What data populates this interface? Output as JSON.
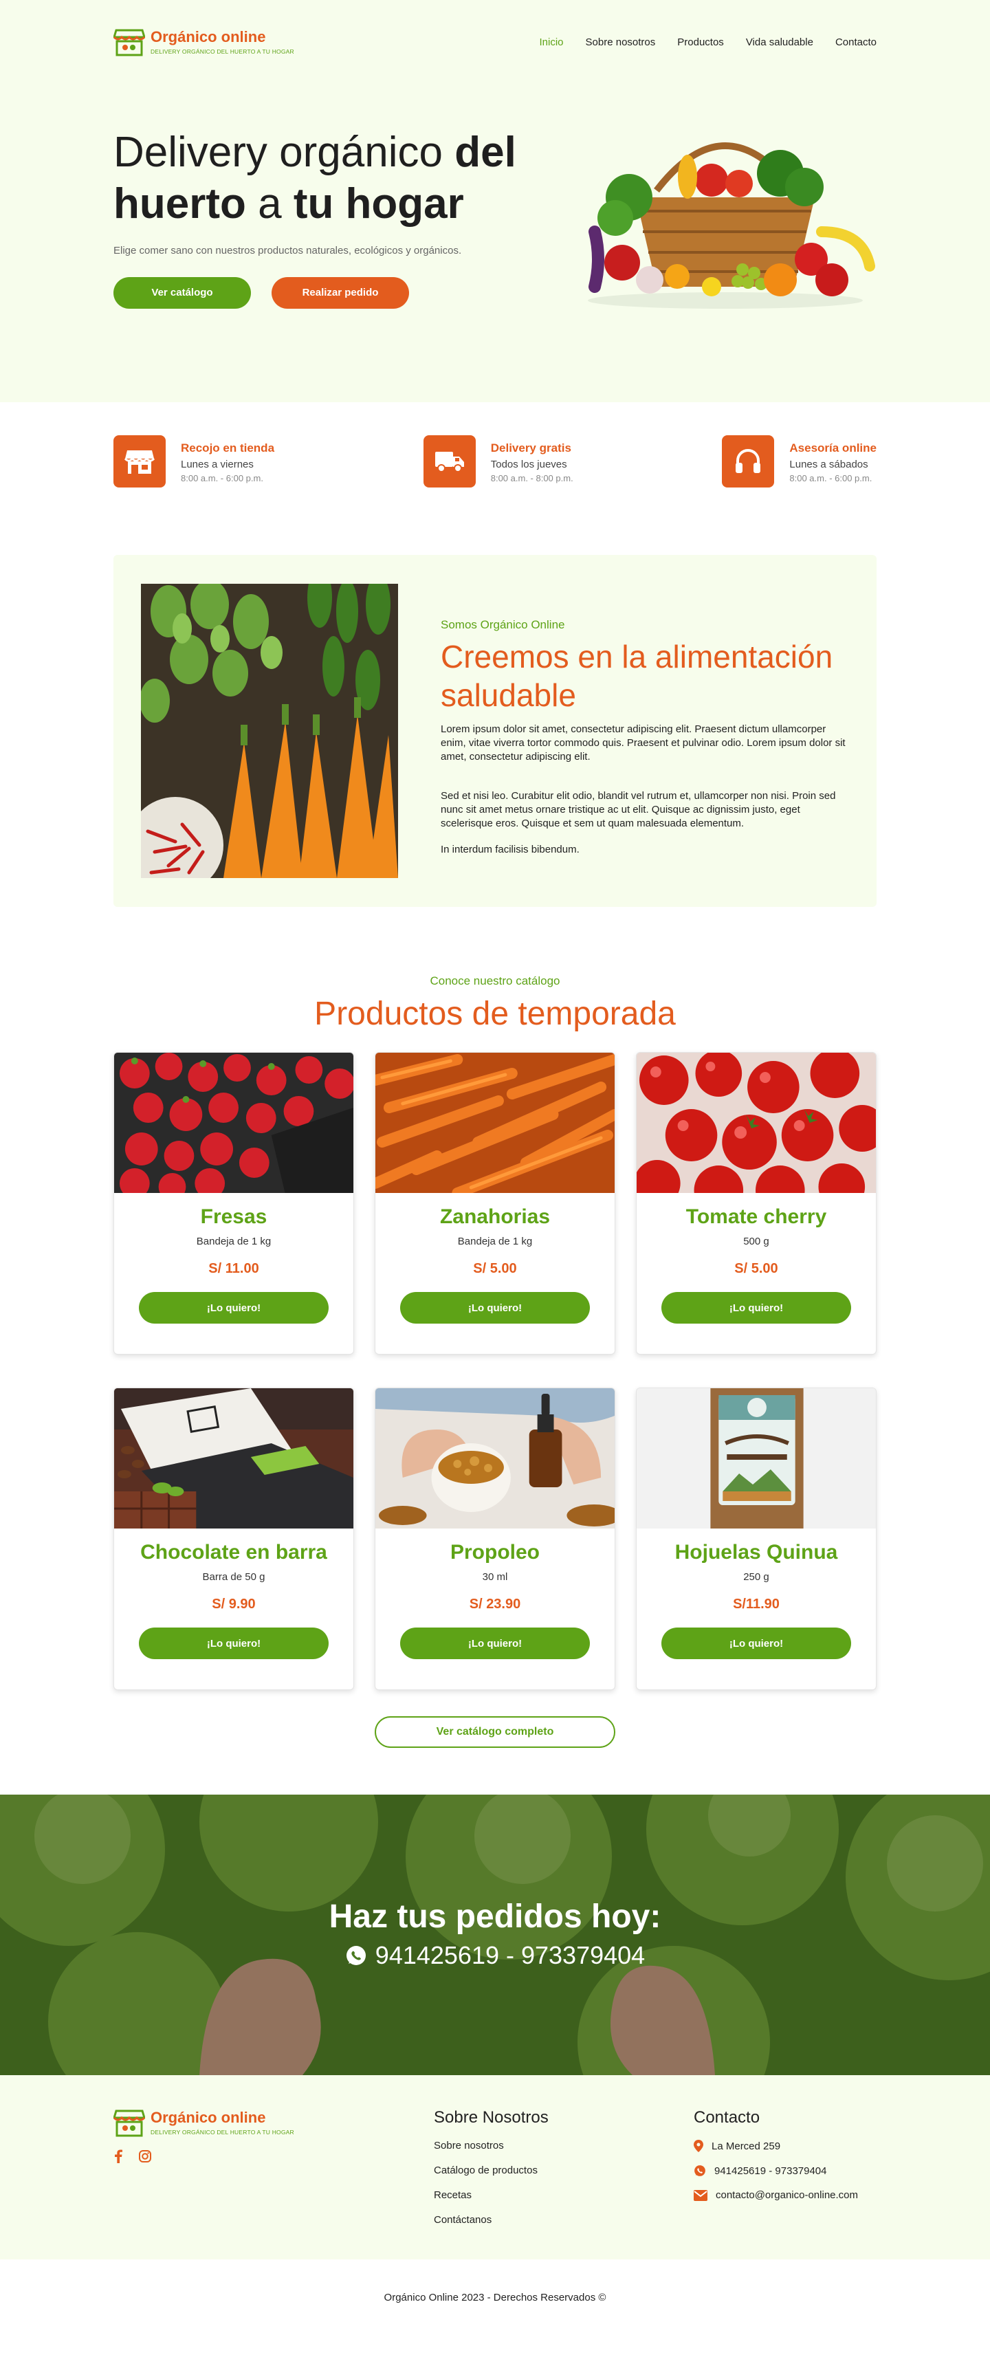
{
  "brand": {
    "name": "Orgánico online",
    "tagline": "DELIVERY ORGÁNICO DEL HUERTO A TU HOGAR"
  },
  "nav": {
    "items": [
      "Inicio",
      "Sobre nosotros",
      "Productos",
      "Vida saludable",
      "Contacto"
    ],
    "active": "Inicio"
  },
  "hero": {
    "title_part1": "Delivery orgánico ",
    "title_bold1": "del huerto",
    "title_part2": " a ",
    "title_bold2": "tu hogar",
    "subtitle": "Elige comer sano con nuestros productos naturales, ecológicos y orgánicos.",
    "btn_catalog": "Ver catálogo",
    "btn_order": "Realizar pedido"
  },
  "features": [
    {
      "icon": "store-icon",
      "title": "Recojo en tienda",
      "line1": "Lunes a viernes",
      "line2": "8:00 a.m. - 6:00 p.m."
    },
    {
      "icon": "truck-icon",
      "title": "Delivery gratis",
      "line1": "Todos los jueves",
      "line2": "8:00 a.m. - 8:00 p.m."
    },
    {
      "icon": "headphones-icon",
      "title": "Asesoría online",
      "line1": "Lunes a sábados",
      "line2": "8:00 a.m. - 6:00 p.m."
    }
  ],
  "about": {
    "kicker": "Somos Orgánico Online",
    "title": "Creemos en la alimentación saludable",
    "p1": "Lorem ipsum dolor sit amet, consectetur adipiscing elit. Praesent dictum ullamcorper enim, vitae viverra tortor commodo quis. Praesent et pulvinar odio. Lorem ipsum dolor sit amet, consectetur adipiscing elit.",
    "p2": "Sed et nisi leo. Curabitur elit odio, blandit vel rutrum et, ullamcorper non nisi. Proin sed nunc sit amet metus ornare tristique ac ut elit. Quisque ac dignissim justo, eget scelerisque eros. Quisque et sem ut quam malesuada elementum.",
    "p3": "In interdum facilisis bibendum."
  },
  "catalog": {
    "kicker": "Conoce nuestro catálogo",
    "title": "Productos de temporada",
    "button_label": "¡Lo quiero!",
    "more": "Ver catálogo completo",
    "products": [
      {
        "name": "Fresas",
        "desc": "Bandeja de 1 kg",
        "price": "S/ 11.00"
      },
      {
        "name": "Zanahorias",
        "desc": "Bandeja de 1 kg",
        "price": "S/ 5.00"
      },
      {
        "name": "Tomate cherry",
        "desc": "500 g",
        "price": "S/ 5.00"
      },
      {
        "name": "Chocolate en barra",
        "desc": "Barra de 50 g",
        "price": "S/ 9.90"
      },
      {
        "name": "Propoleo",
        "desc": "30 ml",
        "price": "S/ 23.90"
      },
      {
        "name": "Hojuelas Quinua",
        "desc": "250 g",
        "price": "S/11.90"
      }
    ]
  },
  "banner": {
    "title": "Haz tus pedidos hoy:",
    "phone": "941425619 - 973379404"
  },
  "footer": {
    "about_title": "Sobre Nosotros",
    "links": [
      "Sobre nosotros",
      "Catálogo de productos",
      "Recetas",
      "Contáctanos"
    ],
    "contact_title": "Contacto",
    "address": "La Merced 259",
    "phone": "941425619 - 973379404",
    "email": "contacto@organico-online.com",
    "copyright": "Orgánico Online 2023 - Derechos Reservados ©"
  },
  "colors": {
    "green": "#5ea317",
    "orange": "#e35c1e",
    "light_bg": "#f7fdec"
  }
}
